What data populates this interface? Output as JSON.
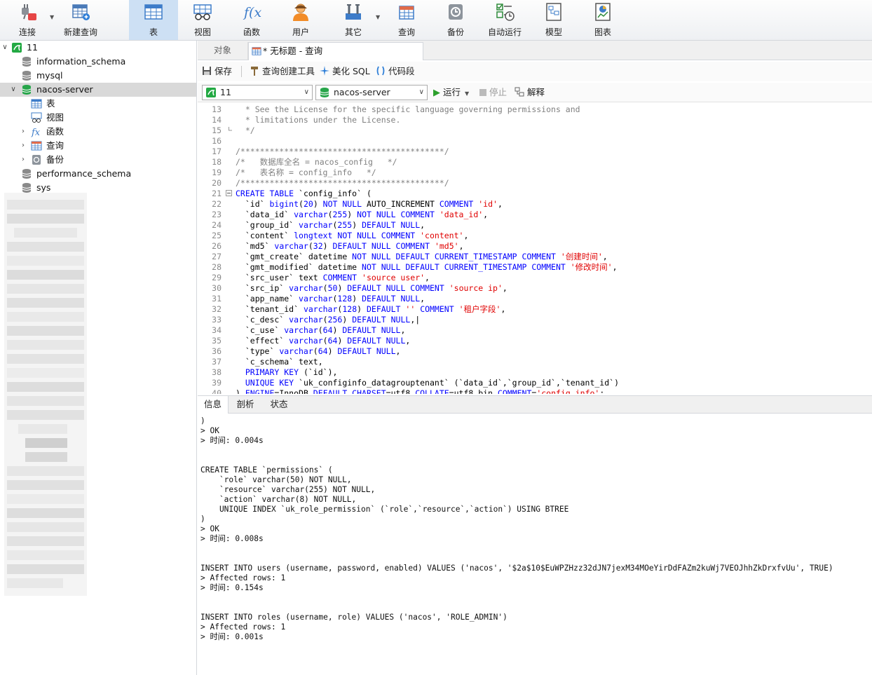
{
  "toolbar": {
    "connect": "连接",
    "new_query": "新建查询",
    "table": "表",
    "view": "视图",
    "function": "函数",
    "user": "用户",
    "other": "其它",
    "query": "查询",
    "backup": "备份",
    "auto_run": "自动运行",
    "model": "模型",
    "chart": "图表"
  },
  "tree": {
    "connection": "11",
    "databases": [
      "information_schema",
      "mysql",
      "nacos-server",
      "performance_schema",
      "sys"
    ],
    "children": [
      "表",
      "视图",
      "函数",
      "查询",
      "备份"
    ]
  },
  "tabs": {
    "objects": "对象",
    "query_title": "* 无标题 - 查询"
  },
  "editor_tools": {
    "save": "保存",
    "query_builder": "查询创建工具",
    "beautify": "美化 SQL",
    "snippet": "代码段"
  },
  "selectors": {
    "connection": "11",
    "database": "nacos-server",
    "run": "运行",
    "stop": "停止",
    "explain": "解释"
  },
  "code": {
    "line_numbers": [
      "13",
      "14",
      "15",
      "16",
      "17",
      "18",
      "19",
      "20",
      "21",
      "22",
      "23",
      "24",
      "25",
      "26",
      "27",
      "28",
      "29",
      "30",
      "31",
      "32",
      "33",
      "34",
      "35",
      "36",
      "37",
      "38",
      "39"
    ]
  },
  "messages": {
    "tabs": [
      "信息",
      "剖析",
      "状态"
    ],
    "lines": [
      ")",
      "> OK",
      "> 时间: 0.004s",
      "",
      "",
      "CREATE TABLE `permissions` (",
      "    `role` varchar(50) NOT NULL,",
      "    `resource` varchar(255) NOT NULL,",
      "    `action` varchar(8) NOT NULL,",
      "    UNIQUE INDEX `uk_role_permission` (`role`,`resource`,`action`) USING BTREE",
      ")",
      "> OK",
      "> 时间: 0.008s",
      "",
      "",
      "INSERT INTO users (username, password, enabled) VALUES ('nacos', '$2a$10$EuWPZHzz32dJN7jexM34MOeYirDdFAZm2kuWj7VEOJhhZkDrxfvUu', TRUE)",
      "> Affected rows: 1",
      "> 时间: 0.154s",
      "",
      "",
      "INSERT INTO roles (username, role) VALUES ('nacos', 'ROLE_ADMIN')",
      "> Affected rows: 1",
      "> 时间: 0.001s"
    ]
  }
}
